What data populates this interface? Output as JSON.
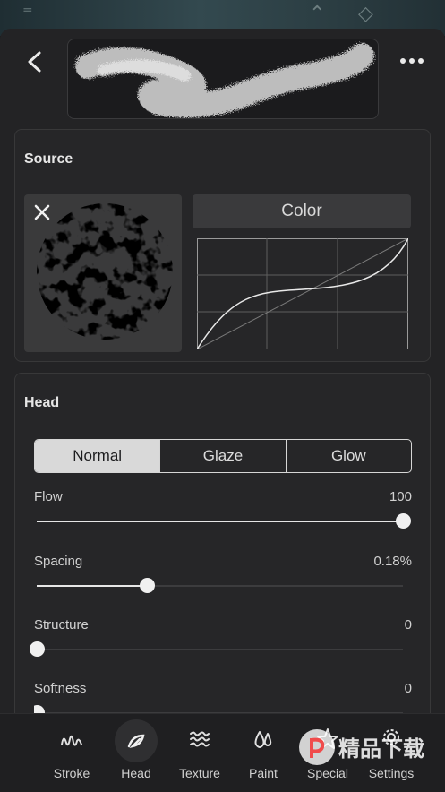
{
  "nav": {
    "back_icon": "chevron-left-icon",
    "more_icon": "more-icon"
  },
  "source": {
    "title": "Source",
    "color_label": "Color",
    "close_icon": "close-icon"
  },
  "head": {
    "title": "Head",
    "modes": [
      "Normal",
      "Glaze",
      "Glow"
    ],
    "selected_mode": "Normal",
    "sliders": [
      {
        "label": "Flow",
        "value": "100",
        "level": 1.0
      },
      {
        "label": "Spacing",
        "value": "0.18%",
        "level": 0.3
      },
      {
        "label": "Structure",
        "value": "0",
        "level": 0.0
      },
      {
        "label": "Softness",
        "value": "0",
        "level": 0.0
      }
    ]
  },
  "tabs": [
    {
      "label": "Stroke",
      "icon": "stroke-icon"
    },
    {
      "label": "Head",
      "icon": "head-icon",
      "active": true
    },
    {
      "label": "Texture",
      "icon": "texture-icon"
    },
    {
      "label": "Paint",
      "icon": "paint-drops-icon"
    },
    {
      "label": "Special",
      "icon": "star-icon"
    },
    {
      "label": "Settings",
      "icon": "gear-icon"
    }
  ],
  "watermark": {
    "text": "精品下载"
  }
}
